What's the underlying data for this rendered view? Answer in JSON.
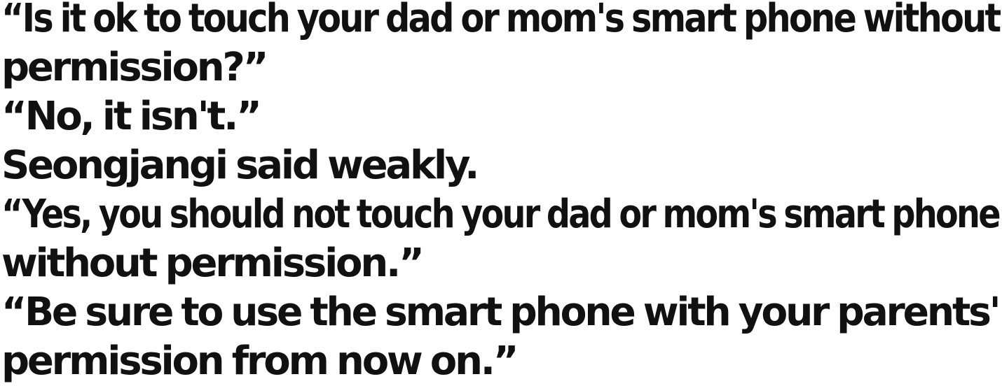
{
  "document": {
    "lines": [
      "“Is it ok to touch your dad or mom's smart phone without",
      "permission?”",
      "“No, it isn't.”",
      "Seongjangi said weakly.",
      "“Yes, you should not touch your dad or mom's smart phone",
      "without permission.”",
      "“Be sure to use the smart phone with your parents'",
      "permission from now on.”"
    ]
  }
}
